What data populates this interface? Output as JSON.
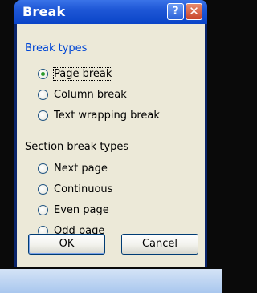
{
  "window": {
    "title": "Break",
    "help_glyph": "?",
    "close_glyph": "✕"
  },
  "break_types": {
    "label": "Break types",
    "options": [
      {
        "label": "Page break",
        "checked": true
      },
      {
        "label": "Column break",
        "checked": false
      },
      {
        "label": "Text wrapping break",
        "checked": false
      }
    ]
  },
  "section_break_types": {
    "label": "Section break types",
    "options": [
      {
        "label": "Next page",
        "checked": false
      },
      {
        "label": "Continuous",
        "checked": false
      },
      {
        "label": "Even page",
        "checked": false
      },
      {
        "label": "Odd page",
        "checked": false
      }
    ]
  },
  "buttons": {
    "ok": "OK",
    "cancel": "Cancel"
  },
  "colors": {
    "title_bar": "#0a44c8",
    "group_label": "#0046d5",
    "dialog_face": "#ece9d8",
    "radio_dot": "#2b9a2b"
  }
}
